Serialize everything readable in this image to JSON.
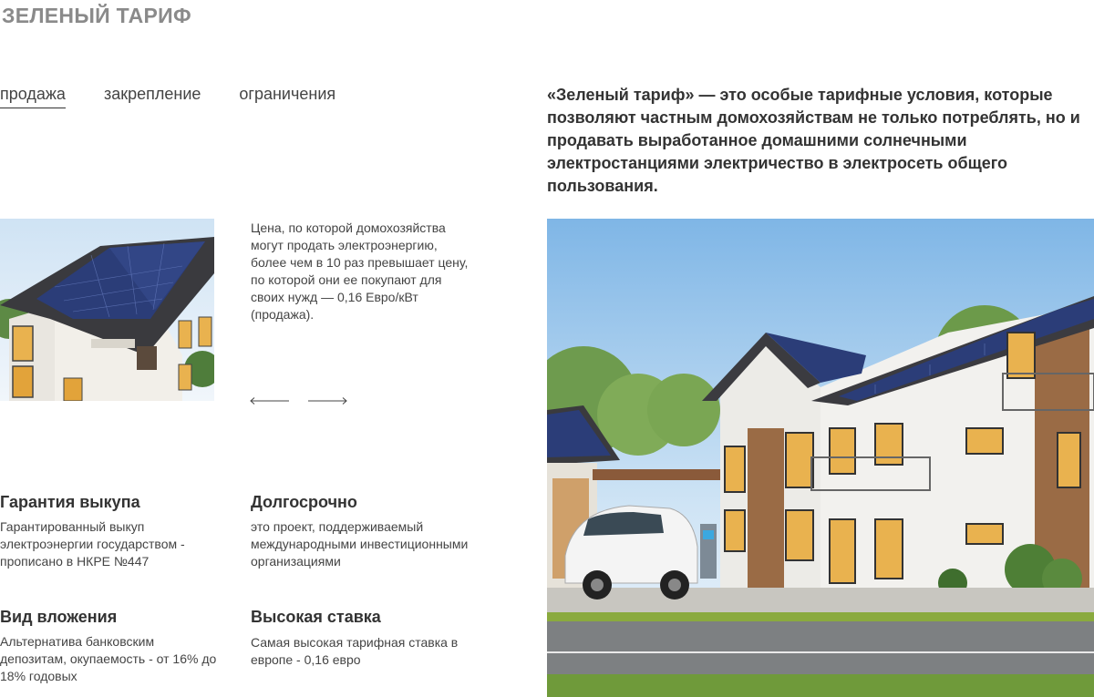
{
  "page": {
    "title": "ЗЕЛЕНЫЙ ТАРИФ"
  },
  "tabs": [
    {
      "label": "продажа",
      "active": true
    },
    {
      "label": "закрепление",
      "active": false
    },
    {
      "label": "ограничения",
      "active": false
    }
  ],
  "intro": {
    "text": "«Зеленый тариф» — это особые тарифные условия, которые позволяют частным домохозяйствам  не только потреблять, но и продавать выработанное домашними солнечными электростанциями электричество в электросеть общего пользования."
  },
  "slider": {
    "description": "Цена, по которой домохозяйства могут продать электроэнергию, более чем в 10 раз превышает цену, по которой они ее покупают для своих нужд — 0,16 Евро/кВт (продажа).",
    "prev_icon": "arrow-left-icon",
    "next_icon": "arrow-right-icon"
  },
  "features": [
    {
      "title": "Гарантия выкупа",
      "text": "Гарантированный выкуп электроэнергии государством - прописано в НКРЕ №447"
    },
    {
      "title": "Долгосрочно",
      "text": "это проект, поддерживаемый международными инвестиционными организациями"
    },
    {
      "title": "Вид вложения",
      "text": "Альтернатива банковским депозитам, окупаемость - от 16% до 18% годовых"
    },
    {
      "title": "Высокая ставка",
      "text": "Самая высокая тарифная ставка в европе - 0,16 евро"
    }
  ],
  "colors": {
    "title_gray": "#8a8a8a",
    "text": "#333333",
    "solar_panel": "#2b3d78"
  }
}
